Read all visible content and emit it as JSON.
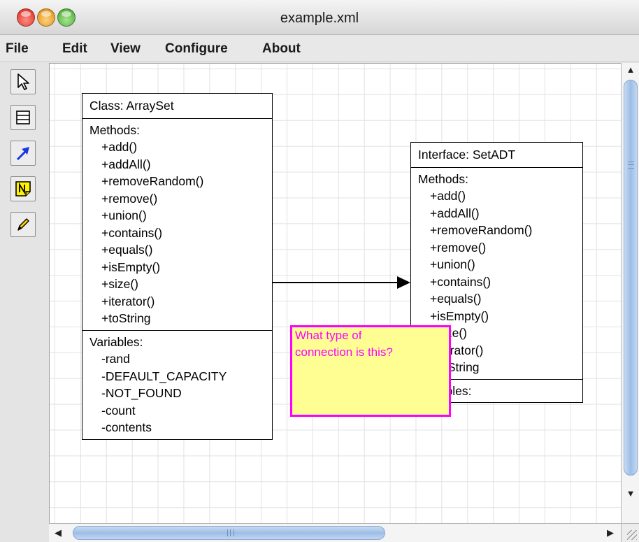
{
  "window": {
    "title": "example.xml"
  },
  "menu": [
    "File",
    "Edit",
    "View",
    "Configure",
    "About"
  ],
  "tools": [
    {
      "name": "select-tool",
      "icon": "arrow-pointer-icon"
    },
    {
      "name": "class-tool",
      "icon": "class-box-icon"
    },
    {
      "name": "association-tool",
      "icon": "blue-arrow-icon"
    },
    {
      "name": "note-tool",
      "icon": "note-icon"
    },
    {
      "name": "pencil-tool",
      "icon": "pencil-icon"
    }
  ],
  "diagram": {
    "class_box": {
      "title": "Class: ArraySet",
      "methods_label": "Methods:",
      "methods": [
        "+add()",
        "+addAll()",
        "+removeRandom()",
        "+remove()",
        "+union()",
        "+contains()",
        "+equals()",
        "+isEmpty()",
        "+size()",
        "+iterator()",
        "+toString"
      ],
      "variables_label": "Variables:",
      "variables": [
        "-rand",
        "-DEFAULT_CAPACITY",
        "-NOT_FOUND",
        "-count",
        "-contents"
      ]
    },
    "interface_box": {
      "title": "Interface: SetADT",
      "methods_label": "Methods:",
      "methods": [
        "+add()",
        "+addAll()",
        "+removeRandom()",
        "+remove()",
        "+union()",
        "+contains()",
        "+equals()",
        "+isEmpty()",
        "+size()",
        "+iterator()",
        "+toString"
      ],
      "variables_label": "Variables:"
    },
    "note": {
      "text_line1": "What type of",
      "text_line2": "connection is this?"
    }
  },
  "colors": {
    "note_fill": "#fefe93",
    "note_border": "#ff00ff",
    "scroll_thumb": "#9dbde6"
  }
}
